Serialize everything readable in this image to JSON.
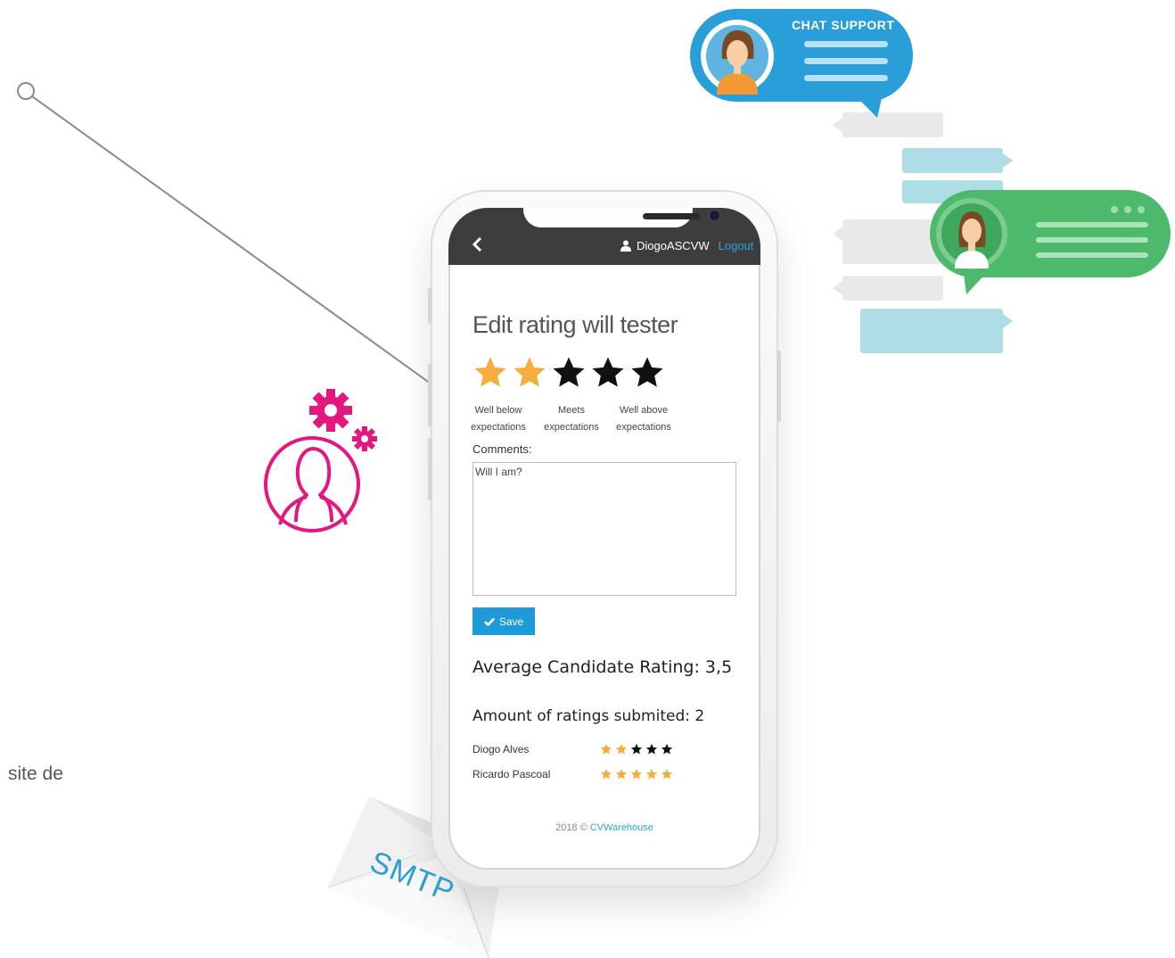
{
  "phone": {
    "header": {
      "back_icon": "chevron-left-icon",
      "username": "DiogoASCVW",
      "logout": "Logout"
    },
    "title": "Edit rating will tester",
    "rating": {
      "current": 2,
      "max": 5,
      "labels": [
        "Well below expectations",
        "Meets expectations",
        "Well above expectations"
      ]
    },
    "comments": {
      "label": "Comments:",
      "value": "Will I am?"
    },
    "save_label": "Save",
    "average_label": "Average Candidate Rating: 3,5",
    "amount_label": "Amount of ratings submited: 2",
    "ratings": [
      {
        "name": "Diogo Alves",
        "stars": 2
      },
      {
        "name": "Ricardo Pascoal",
        "stars": 5
      }
    ],
    "footer": {
      "prefix": "2018 © ",
      "link": "CVWarehouse"
    }
  },
  "decor": {
    "chat_support": "CHAT SUPPORT",
    "side_text": "site de",
    "smtp": "SMTP"
  },
  "colors": {
    "star_filled": "#f7ad3e",
    "star_empty": "#111111",
    "accent": "#1e9ad6",
    "header_bg": "#3d3d3d",
    "chat_blue": "#2a9ed8",
    "chat_green": "#4cba6a",
    "magenta": "#e4177f"
  }
}
